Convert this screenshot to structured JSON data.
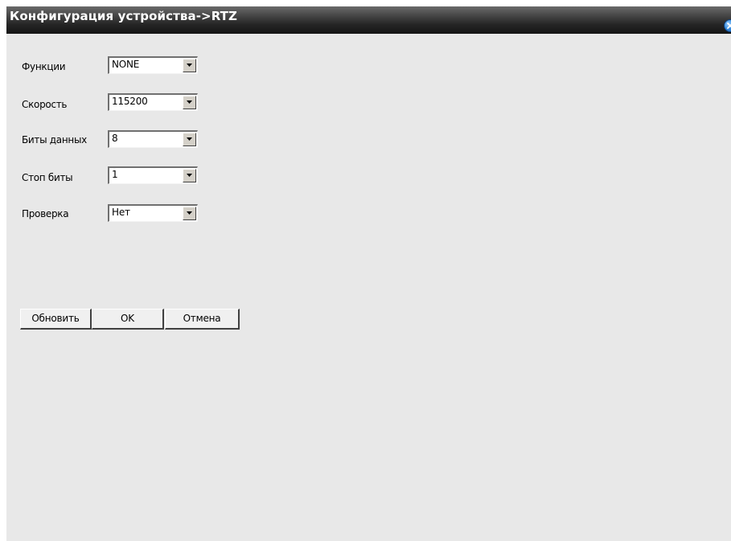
{
  "window": {
    "title": "Конфигурация устройства->RTZ",
    "close_icon": "close-circle-icon"
  },
  "form": {
    "fields": [
      {
        "label": "Функции",
        "value": "NONE"
      },
      {
        "label": "Скорость",
        "value": "115200"
      },
      {
        "label": "Биты данных",
        "value": "8"
      },
      {
        "label": "Стоп биты",
        "value": "1"
      },
      {
        "label": "Проверка",
        "value": "Нет"
      }
    ]
  },
  "buttons": {
    "refresh_label": "Обновить",
    "ok_label": "OK",
    "cancel_label": "Отмена"
  },
  "colors": {
    "panel_background": "#e8e8e8",
    "title_bar": "#1a1a1a",
    "title_text": "#ffffff",
    "close_button": "#3a8fe0"
  }
}
